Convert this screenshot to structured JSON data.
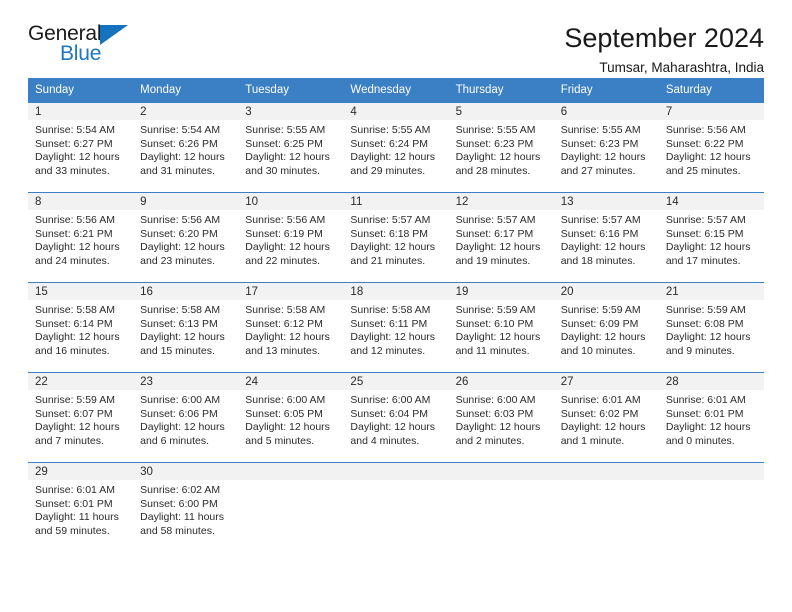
{
  "brand": {
    "name_part1": "General",
    "name_part2": "Blue",
    "mark_icon": "triangle-icon",
    "accent_color": "#1573bd"
  },
  "header": {
    "title": "September 2024",
    "subtitle": "Tumsar, Maharashtra, India"
  },
  "calendar": {
    "header_color": "#3b7fc4",
    "weekdays": [
      "Sunday",
      "Monday",
      "Tuesday",
      "Wednesday",
      "Thursday",
      "Friday",
      "Saturday"
    ],
    "weeks": [
      [
        {
          "day": "1",
          "sunrise": "Sunrise: 5:54 AM",
          "sunset": "Sunset: 6:27 PM",
          "daylight": "Daylight: 12 hours and 33 minutes."
        },
        {
          "day": "2",
          "sunrise": "Sunrise: 5:54 AM",
          "sunset": "Sunset: 6:26 PM",
          "daylight": "Daylight: 12 hours and 31 minutes."
        },
        {
          "day": "3",
          "sunrise": "Sunrise: 5:55 AM",
          "sunset": "Sunset: 6:25 PM",
          "daylight": "Daylight: 12 hours and 30 minutes."
        },
        {
          "day": "4",
          "sunrise": "Sunrise: 5:55 AM",
          "sunset": "Sunset: 6:24 PM",
          "daylight": "Daylight: 12 hours and 29 minutes."
        },
        {
          "day": "5",
          "sunrise": "Sunrise: 5:55 AM",
          "sunset": "Sunset: 6:23 PM",
          "daylight": "Daylight: 12 hours and 28 minutes."
        },
        {
          "day": "6",
          "sunrise": "Sunrise: 5:55 AM",
          "sunset": "Sunset: 6:23 PM",
          "daylight": "Daylight: 12 hours and 27 minutes."
        },
        {
          "day": "7",
          "sunrise": "Sunrise: 5:56 AM",
          "sunset": "Sunset: 6:22 PM",
          "daylight": "Daylight: 12 hours and 25 minutes."
        }
      ],
      [
        {
          "day": "8",
          "sunrise": "Sunrise: 5:56 AM",
          "sunset": "Sunset: 6:21 PM",
          "daylight": "Daylight: 12 hours and 24 minutes."
        },
        {
          "day": "9",
          "sunrise": "Sunrise: 5:56 AM",
          "sunset": "Sunset: 6:20 PM",
          "daylight": "Daylight: 12 hours and 23 minutes."
        },
        {
          "day": "10",
          "sunrise": "Sunrise: 5:56 AM",
          "sunset": "Sunset: 6:19 PM",
          "daylight": "Daylight: 12 hours and 22 minutes."
        },
        {
          "day": "11",
          "sunrise": "Sunrise: 5:57 AM",
          "sunset": "Sunset: 6:18 PM",
          "daylight": "Daylight: 12 hours and 21 minutes."
        },
        {
          "day": "12",
          "sunrise": "Sunrise: 5:57 AM",
          "sunset": "Sunset: 6:17 PM",
          "daylight": "Daylight: 12 hours and 19 minutes."
        },
        {
          "day": "13",
          "sunrise": "Sunrise: 5:57 AM",
          "sunset": "Sunset: 6:16 PM",
          "daylight": "Daylight: 12 hours and 18 minutes."
        },
        {
          "day": "14",
          "sunrise": "Sunrise: 5:57 AM",
          "sunset": "Sunset: 6:15 PM",
          "daylight": "Daylight: 12 hours and 17 minutes."
        }
      ],
      [
        {
          "day": "15",
          "sunrise": "Sunrise: 5:58 AM",
          "sunset": "Sunset: 6:14 PM",
          "daylight": "Daylight: 12 hours and 16 minutes."
        },
        {
          "day": "16",
          "sunrise": "Sunrise: 5:58 AM",
          "sunset": "Sunset: 6:13 PM",
          "daylight": "Daylight: 12 hours and 15 minutes."
        },
        {
          "day": "17",
          "sunrise": "Sunrise: 5:58 AM",
          "sunset": "Sunset: 6:12 PM",
          "daylight": "Daylight: 12 hours and 13 minutes."
        },
        {
          "day": "18",
          "sunrise": "Sunrise: 5:58 AM",
          "sunset": "Sunset: 6:11 PM",
          "daylight": "Daylight: 12 hours and 12 minutes."
        },
        {
          "day": "19",
          "sunrise": "Sunrise: 5:59 AM",
          "sunset": "Sunset: 6:10 PM",
          "daylight": "Daylight: 12 hours and 11 minutes."
        },
        {
          "day": "20",
          "sunrise": "Sunrise: 5:59 AM",
          "sunset": "Sunset: 6:09 PM",
          "daylight": "Daylight: 12 hours and 10 minutes."
        },
        {
          "day": "21",
          "sunrise": "Sunrise: 5:59 AM",
          "sunset": "Sunset: 6:08 PM",
          "daylight": "Daylight: 12 hours and 9 minutes."
        }
      ],
      [
        {
          "day": "22",
          "sunrise": "Sunrise: 5:59 AM",
          "sunset": "Sunset: 6:07 PM",
          "daylight": "Daylight: 12 hours and 7 minutes."
        },
        {
          "day": "23",
          "sunrise": "Sunrise: 6:00 AM",
          "sunset": "Sunset: 6:06 PM",
          "daylight": "Daylight: 12 hours and 6 minutes."
        },
        {
          "day": "24",
          "sunrise": "Sunrise: 6:00 AM",
          "sunset": "Sunset: 6:05 PM",
          "daylight": "Daylight: 12 hours and 5 minutes."
        },
        {
          "day": "25",
          "sunrise": "Sunrise: 6:00 AM",
          "sunset": "Sunset: 6:04 PM",
          "daylight": "Daylight: 12 hours and 4 minutes."
        },
        {
          "day": "26",
          "sunrise": "Sunrise: 6:00 AM",
          "sunset": "Sunset: 6:03 PM",
          "daylight": "Daylight: 12 hours and 2 minutes."
        },
        {
          "day": "27",
          "sunrise": "Sunrise: 6:01 AM",
          "sunset": "Sunset: 6:02 PM",
          "daylight": "Daylight: 12 hours and 1 minute."
        },
        {
          "day": "28",
          "sunrise": "Sunrise: 6:01 AM",
          "sunset": "Sunset: 6:01 PM",
          "daylight": "Daylight: 12 hours and 0 minutes."
        }
      ],
      [
        {
          "day": "29",
          "sunrise": "Sunrise: 6:01 AM",
          "sunset": "Sunset: 6:01 PM",
          "daylight": "Daylight: 11 hours and 59 minutes."
        },
        {
          "day": "30",
          "sunrise": "Sunrise: 6:02 AM",
          "sunset": "Sunset: 6:00 PM",
          "daylight": "Daylight: 11 hours and 58 minutes."
        },
        {
          "day": "",
          "sunrise": "",
          "sunset": "",
          "daylight": ""
        },
        {
          "day": "",
          "sunrise": "",
          "sunset": "",
          "daylight": ""
        },
        {
          "day": "",
          "sunrise": "",
          "sunset": "",
          "daylight": ""
        },
        {
          "day": "",
          "sunrise": "",
          "sunset": "",
          "daylight": ""
        },
        {
          "day": "",
          "sunrise": "",
          "sunset": "",
          "daylight": ""
        }
      ]
    ]
  }
}
